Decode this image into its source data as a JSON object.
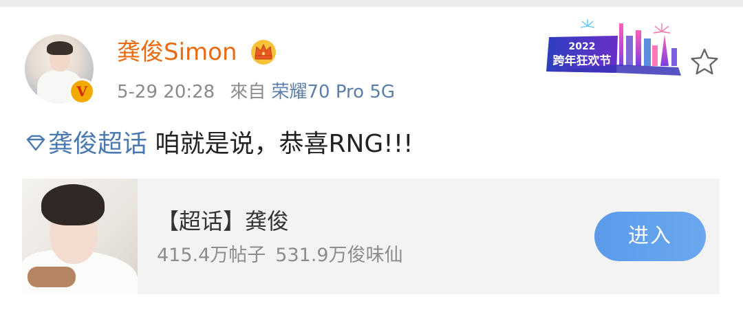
{
  "post": {
    "username": "龚俊Simon",
    "timestamp": "5-29 20:28",
    "source_prefix": "來自",
    "device": "荣耀70 Pro 5G",
    "event_badge_year": "2022",
    "event_badge_text": "跨年狂欢节",
    "topic_link": "龚俊超话",
    "content": " 咱就是说，恭喜RNG!!!",
    "icons": [
      "avatar",
      "verified-v-icon",
      "crown-icon",
      "event-badge",
      "star-icon",
      "diamond-icon"
    ],
    "colors": {
      "username": "#e86b10",
      "link": "#4a78b0",
      "meta": "#8a8a8a",
      "device": "#5b7fa8",
      "button": "#5a9bea"
    }
  },
  "card": {
    "title": "【超话】龚俊",
    "posts_count": "415.4万帖子",
    "fans_count": "531.9万俊味仙",
    "enter_label": "进入"
  }
}
